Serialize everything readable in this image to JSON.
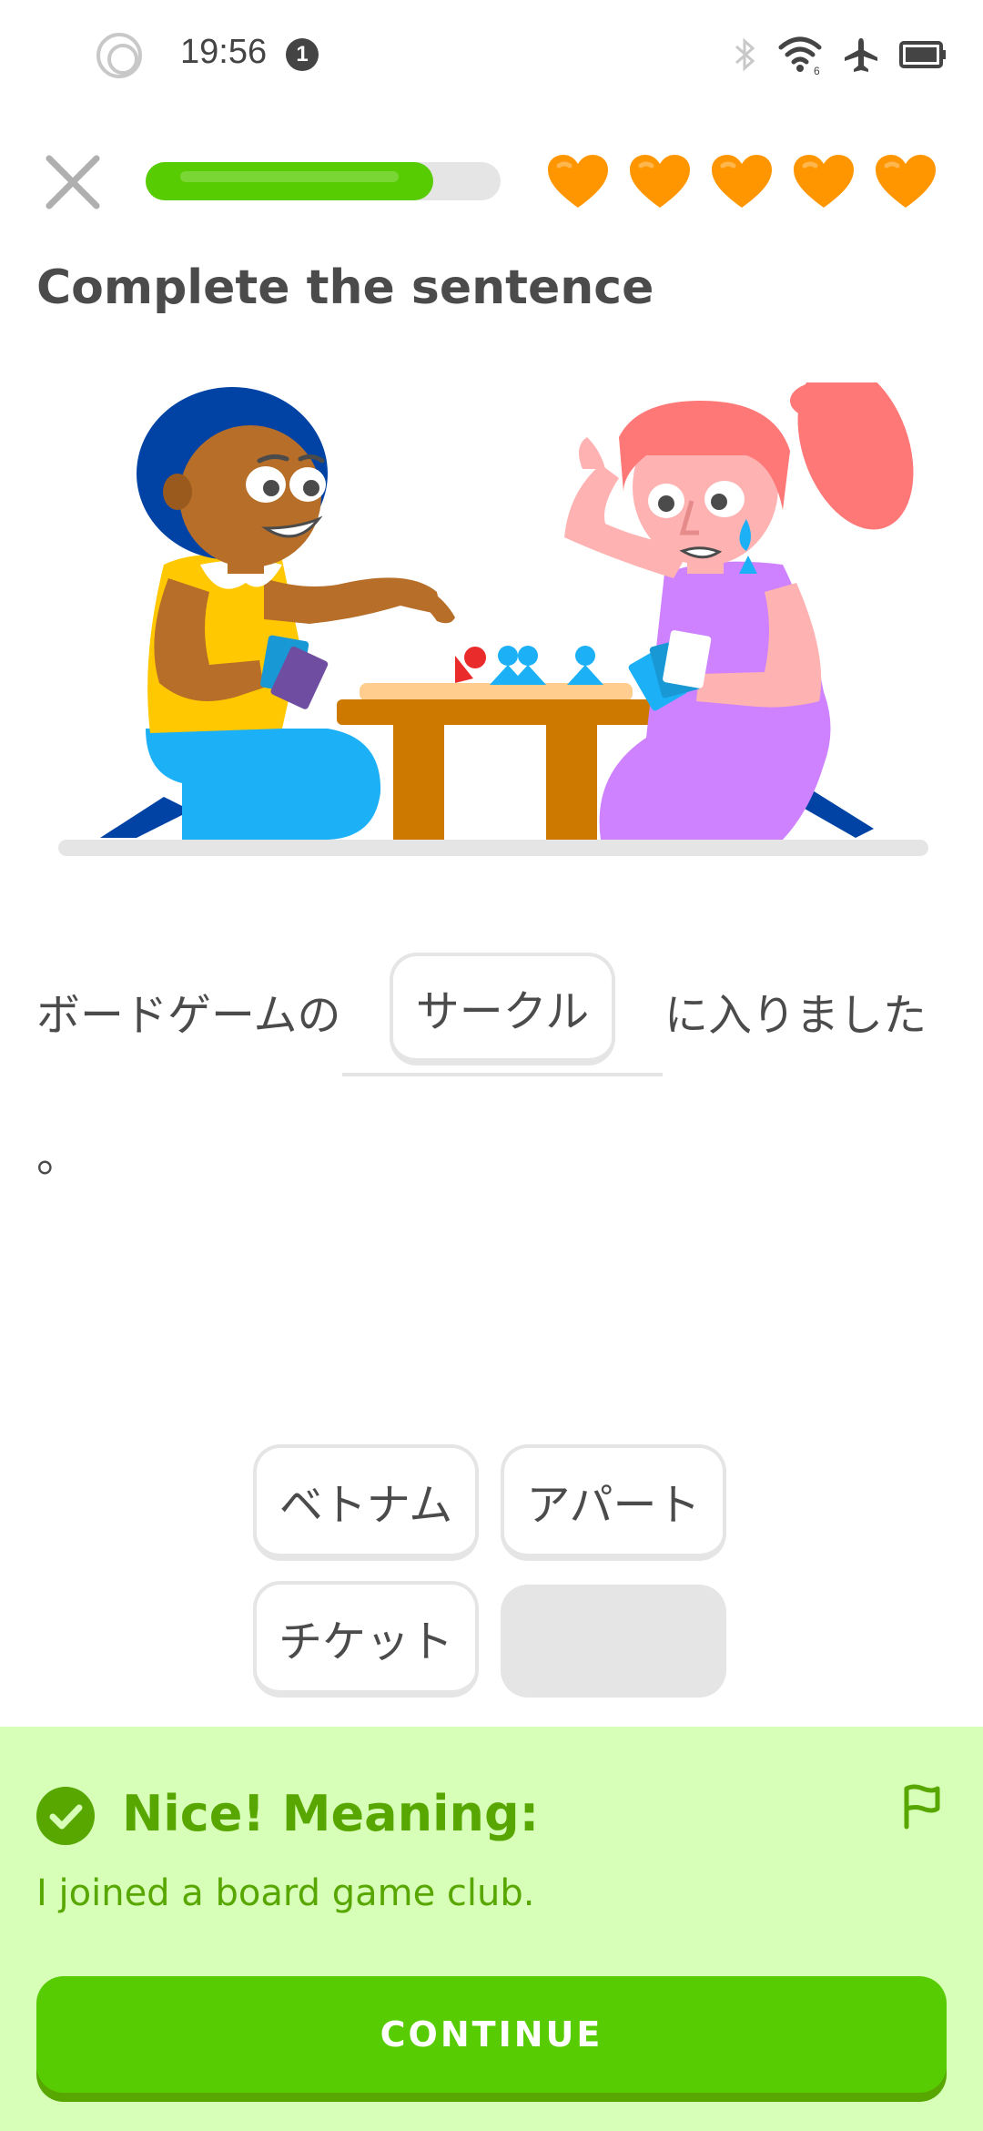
{
  "status_bar": {
    "time": "19:56",
    "notification_count": "1",
    "icons": [
      "bluetooth-icon",
      "wifi-icon",
      "airplane-mode-icon",
      "battery-icon"
    ]
  },
  "header": {
    "progress_fraction": 0.81,
    "hearts": 5,
    "colors": {
      "progress": "#58cc02",
      "heart": "#ff9600"
    }
  },
  "lesson": {
    "instruction": "Complete the sentence",
    "sentence_before": "ボードゲームの",
    "selected_answer": "サークル",
    "sentence_after": "に入りました",
    "sentence_end": "。"
  },
  "word_bank": {
    "options": [
      "ベトナム",
      "アパート",
      "チケット"
    ]
  },
  "feedback": {
    "title": "Nice! Meaning:",
    "meaning": "I joined a board game club.",
    "continue_label": "CONTINUE",
    "colors": {
      "panel": "#d7ffb8",
      "text": "#58a700",
      "button": "#58cc02"
    }
  }
}
